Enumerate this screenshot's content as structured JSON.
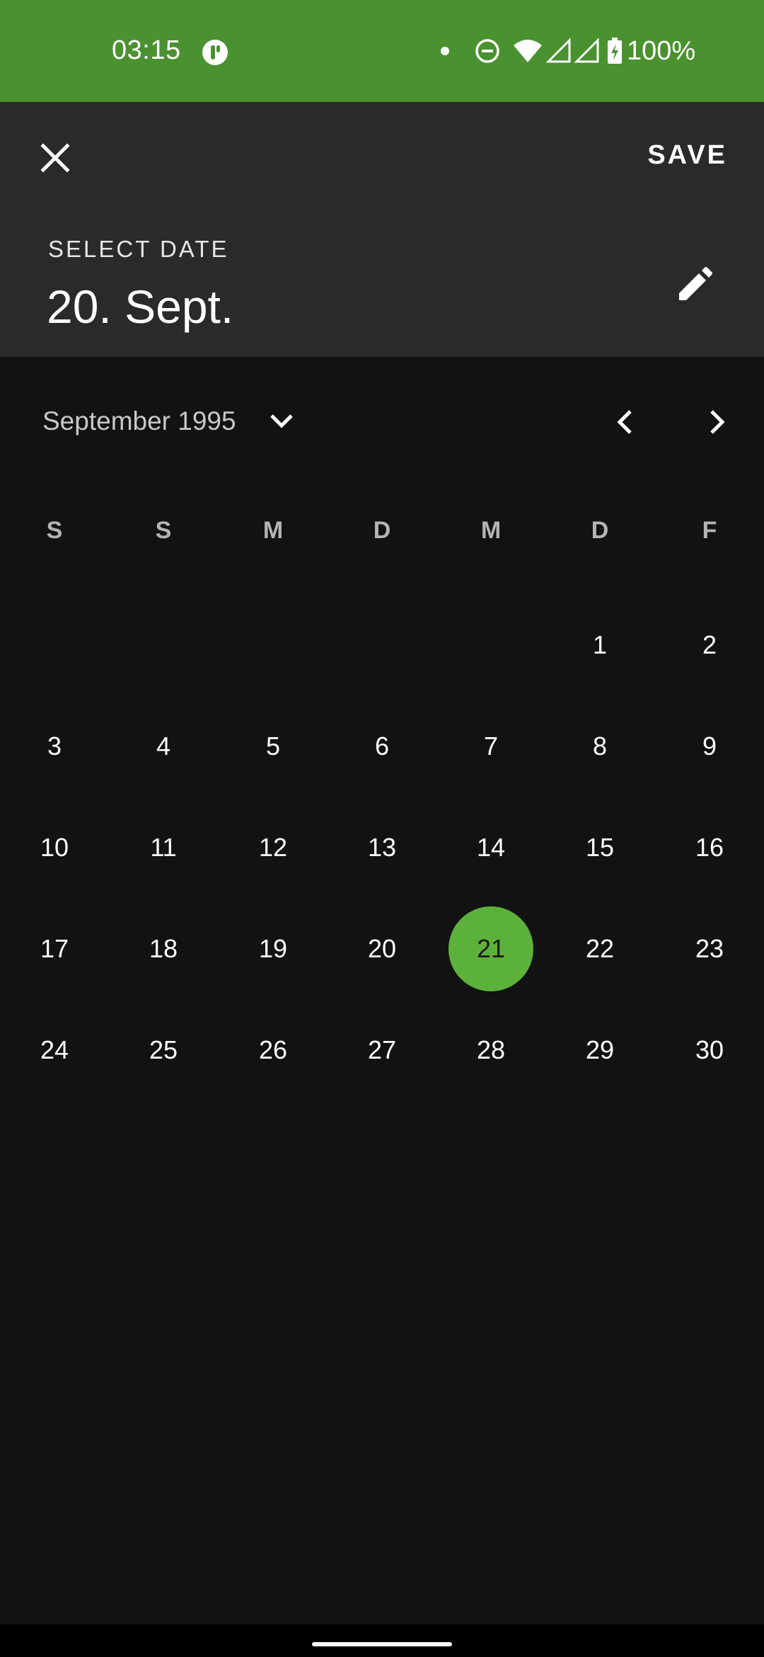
{
  "status_bar": {
    "time": "03:15",
    "battery": "100%",
    "bg_color": "#4a9130"
  },
  "header": {
    "close_icon": "close-icon",
    "save_label": "SAVE",
    "select_label": "SELECT DATE",
    "selected_date": "20. Sept.",
    "edit_icon": "pencil-icon"
  },
  "calendar": {
    "month_label": "September 1995",
    "weekdays": [
      "S",
      "S",
      "M",
      "D",
      "M",
      "D",
      "F"
    ],
    "weeks": [
      [
        "",
        "",
        "",
        "",
        "",
        "1",
        "2"
      ],
      [
        "3",
        "4",
        "5",
        "6",
        "7",
        "8",
        "9"
      ],
      [
        "10",
        "11",
        "12",
        "13",
        "14",
        "15",
        "16"
      ],
      [
        "17",
        "18",
        "19",
        "20",
        "21",
        "22",
        "23"
      ],
      [
        "24",
        "25",
        "26",
        "27",
        "28",
        "29",
        "30"
      ]
    ],
    "highlighted_day": "21",
    "accent_color": "#5cb13a"
  }
}
